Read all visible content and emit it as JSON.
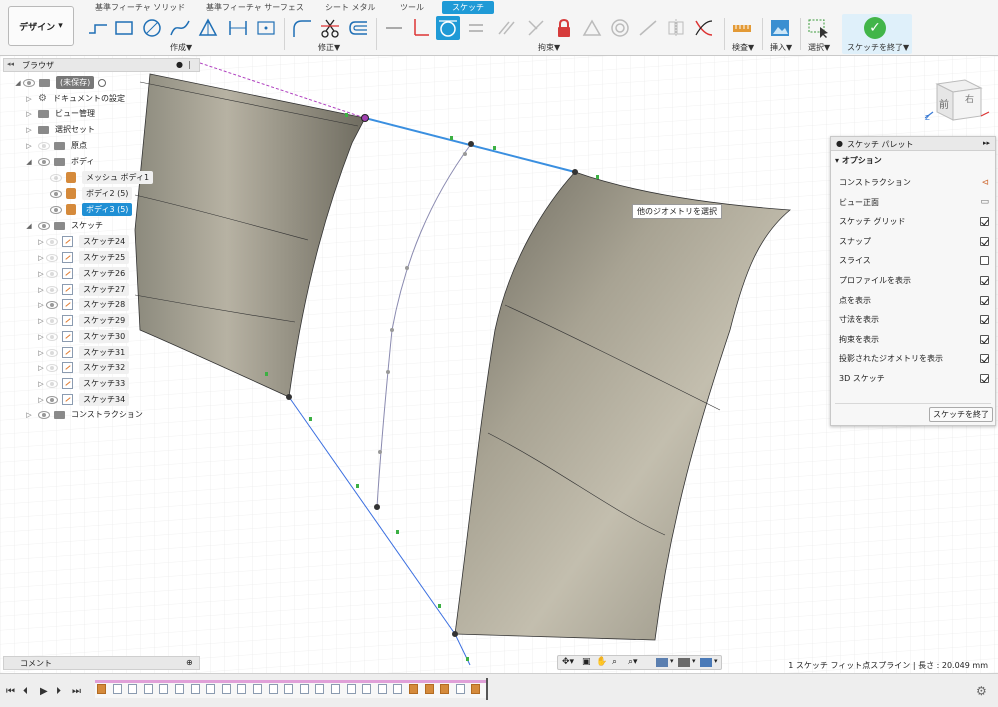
{
  "toolbar": {
    "design_label": "デザイン",
    "tabs": [
      "基準フィーチャ ソリッド",
      "基準フィーチャ サーフェス",
      "シート メタル",
      "ツール",
      "スケッチ"
    ],
    "groups": {
      "create": "作成▼",
      "modify": "修正▼",
      "constraint": "拘束▼",
      "inspect": "検査▼",
      "insert": "挿入▼",
      "select": "選択▼",
      "finish": "スケッチを終了▼"
    }
  },
  "browser": {
    "title": "ブラウザ",
    "root": "(未保存)",
    "items": [
      {
        "label": "ドキュメントの設定"
      },
      {
        "label": "ビュー管理"
      },
      {
        "label": "選択セット"
      },
      {
        "label": "原点"
      },
      {
        "label": "ボディ"
      },
      {
        "label": "メッシュ ボディ1"
      },
      {
        "label": "ボディ2 (5)"
      },
      {
        "label": "ボディ3 (5)"
      },
      {
        "label": "スケッチ"
      },
      {
        "label": "スケッチ24"
      },
      {
        "label": "スケッチ25"
      },
      {
        "label": "スケッチ26"
      },
      {
        "label": "スケッチ27"
      },
      {
        "label": "スケッチ28"
      },
      {
        "label": "スケッチ29"
      },
      {
        "label": "スケッチ30"
      },
      {
        "label": "スケッチ31"
      },
      {
        "label": "スケッチ32"
      },
      {
        "label": "スケッチ33"
      },
      {
        "label": "スケッチ34"
      },
      {
        "label": "コンストラクション"
      }
    ]
  },
  "viewcube": {
    "front": "前",
    "right": "右"
  },
  "tooltip": "他のジオメトリを選択",
  "palette": {
    "title": "スケッチ パレット",
    "section": "オプション",
    "rows": [
      {
        "label": "コンストラクション",
        "control": "icon",
        "checked": false
      },
      {
        "label": "ビュー正面",
        "control": "icon",
        "checked": false
      },
      {
        "label": "スケッチ グリッド",
        "control": "checkbox",
        "checked": true
      },
      {
        "label": "スナップ",
        "control": "checkbox",
        "checked": true
      },
      {
        "label": "スライス",
        "control": "checkbox",
        "checked": false
      },
      {
        "label": "プロファイルを表示",
        "control": "checkbox",
        "checked": true
      },
      {
        "label": "点を表示",
        "control": "checkbox",
        "checked": true
      },
      {
        "label": "寸法を表示",
        "control": "checkbox",
        "checked": true
      },
      {
        "label": "拘束を表示",
        "control": "checkbox",
        "checked": true
      },
      {
        "label": "投影されたジオメトリを表示",
        "control": "checkbox",
        "checked": true
      },
      {
        "label": "3D スケッチ",
        "control": "checkbox",
        "checked": true
      }
    ],
    "finish_button": "スケッチを終了"
  },
  "comments": {
    "label": "コメント"
  },
  "status": {
    "text": "1 スケッチ フィット点スプライン | 長さ : 20.049 mm"
  },
  "colors": {
    "accent": "#1f9ad6",
    "finish_green": "#42b549",
    "selection_blue": "#1f8fd4"
  }
}
